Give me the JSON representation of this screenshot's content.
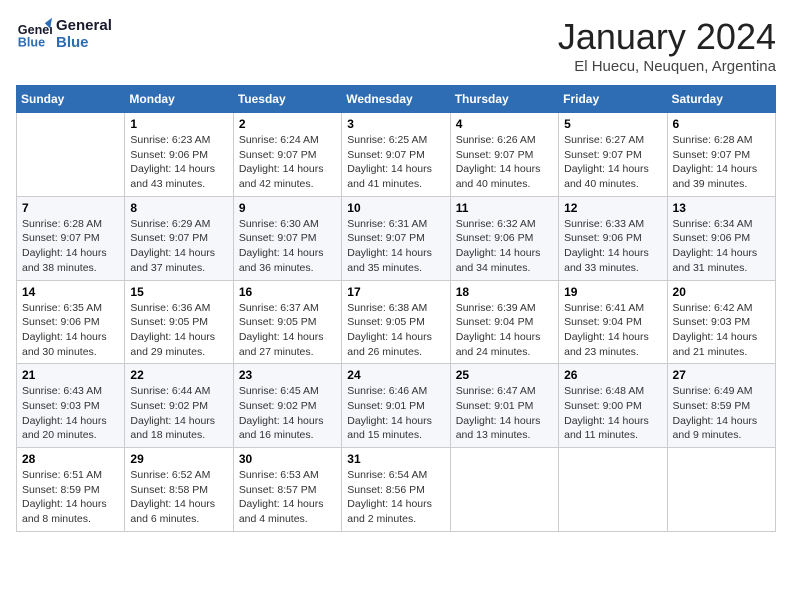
{
  "logo": {
    "line1": "General",
    "line2": "Blue"
  },
  "title": "January 2024",
  "location": "El Huecu, Neuquen, Argentina",
  "weekdays": [
    "Sunday",
    "Monday",
    "Tuesday",
    "Wednesday",
    "Thursday",
    "Friday",
    "Saturday"
  ],
  "weeks": [
    [
      {
        "day": "",
        "sunrise": "",
        "sunset": "",
        "daylight": ""
      },
      {
        "day": "1",
        "sunrise": "Sunrise: 6:23 AM",
        "sunset": "Sunset: 9:06 PM",
        "daylight": "Daylight: 14 hours and 43 minutes."
      },
      {
        "day": "2",
        "sunrise": "Sunrise: 6:24 AM",
        "sunset": "Sunset: 9:07 PM",
        "daylight": "Daylight: 14 hours and 42 minutes."
      },
      {
        "day": "3",
        "sunrise": "Sunrise: 6:25 AM",
        "sunset": "Sunset: 9:07 PM",
        "daylight": "Daylight: 14 hours and 41 minutes."
      },
      {
        "day": "4",
        "sunrise": "Sunrise: 6:26 AM",
        "sunset": "Sunset: 9:07 PM",
        "daylight": "Daylight: 14 hours and 40 minutes."
      },
      {
        "day": "5",
        "sunrise": "Sunrise: 6:27 AM",
        "sunset": "Sunset: 9:07 PM",
        "daylight": "Daylight: 14 hours and 40 minutes."
      },
      {
        "day": "6",
        "sunrise": "Sunrise: 6:28 AM",
        "sunset": "Sunset: 9:07 PM",
        "daylight": "Daylight: 14 hours and 39 minutes."
      }
    ],
    [
      {
        "day": "7",
        "sunrise": "Sunrise: 6:28 AM",
        "sunset": "Sunset: 9:07 PM",
        "daylight": "Daylight: 14 hours and 38 minutes."
      },
      {
        "day": "8",
        "sunrise": "Sunrise: 6:29 AM",
        "sunset": "Sunset: 9:07 PM",
        "daylight": "Daylight: 14 hours and 37 minutes."
      },
      {
        "day": "9",
        "sunrise": "Sunrise: 6:30 AM",
        "sunset": "Sunset: 9:07 PM",
        "daylight": "Daylight: 14 hours and 36 minutes."
      },
      {
        "day": "10",
        "sunrise": "Sunrise: 6:31 AM",
        "sunset": "Sunset: 9:07 PM",
        "daylight": "Daylight: 14 hours and 35 minutes."
      },
      {
        "day": "11",
        "sunrise": "Sunrise: 6:32 AM",
        "sunset": "Sunset: 9:06 PM",
        "daylight": "Daylight: 14 hours and 34 minutes."
      },
      {
        "day": "12",
        "sunrise": "Sunrise: 6:33 AM",
        "sunset": "Sunset: 9:06 PM",
        "daylight": "Daylight: 14 hours and 33 minutes."
      },
      {
        "day": "13",
        "sunrise": "Sunrise: 6:34 AM",
        "sunset": "Sunset: 9:06 PM",
        "daylight": "Daylight: 14 hours and 31 minutes."
      }
    ],
    [
      {
        "day": "14",
        "sunrise": "Sunrise: 6:35 AM",
        "sunset": "Sunset: 9:06 PM",
        "daylight": "Daylight: 14 hours and 30 minutes."
      },
      {
        "day": "15",
        "sunrise": "Sunrise: 6:36 AM",
        "sunset": "Sunset: 9:05 PM",
        "daylight": "Daylight: 14 hours and 29 minutes."
      },
      {
        "day": "16",
        "sunrise": "Sunrise: 6:37 AM",
        "sunset": "Sunset: 9:05 PM",
        "daylight": "Daylight: 14 hours and 27 minutes."
      },
      {
        "day": "17",
        "sunrise": "Sunrise: 6:38 AM",
        "sunset": "Sunset: 9:05 PM",
        "daylight": "Daylight: 14 hours and 26 minutes."
      },
      {
        "day": "18",
        "sunrise": "Sunrise: 6:39 AM",
        "sunset": "Sunset: 9:04 PM",
        "daylight": "Daylight: 14 hours and 24 minutes."
      },
      {
        "day": "19",
        "sunrise": "Sunrise: 6:41 AM",
        "sunset": "Sunset: 9:04 PM",
        "daylight": "Daylight: 14 hours and 23 minutes."
      },
      {
        "day": "20",
        "sunrise": "Sunrise: 6:42 AM",
        "sunset": "Sunset: 9:03 PM",
        "daylight": "Daylight: 14 hours and 21 minutes."
      }
    ],
    [
      {
        "day": "21",
        "sunrise": "Sunrise: 6:43 AM",
        "sunset": "Sunset: 9:03 PM",
        "daylight": "Daylight: 14 hours and 20 minutes."
      },
      {
        "day": "22",
        "sunrise": "Sunrise: 6:44 AM",
        "sunset": "Sunset: 9:02 PM",
        "daylight": "Daylight: 14 hours and 18 minutes."
      },
      {
        "day": "23",
        "sunrise": "Sunrise: 6:45 AM",
        "sunset": "Sunset: 9:02 PM",
        "daylight": "Daylight: 14 hours and 16 minutes."
      },
      {
        "day": "24",
        "sunrise": "Sunrise: 6:46 AM",
        "sunset": "Sunset: 9:01 PM",
        "daylight": "Daylight: 14 hours and 15 minutes."
      },
      {
        "day": "25",
        "sunrise": "Sunrise: 6:47 AM",
        "sunset": "Sunset: 9:01 PM",
        "daylight": "Daylight: 14 hours and 13 minutes."
      },
      {
        "day": "26",
        "sunrise": "Sunrise: 6:48 AM",
        "sunset": "Sunset: 9:00 PM",
        "daylight": "Daylight: 14 hours and 11 minutes."
      },
      {
        "day": "27",
        "sunrise": "Sunrise: 6:49 AM",
        "sunset": "Sunset: 8:59 PM",
        "daylight": "Daylight: 14 hours and 9 minutes."
      }
    ],
    [
      {
        "day": "28",
        "sunrise": "Sunrise: 6:51 AM",
        "sunset": "Sunset: 8:59 PM",
        "daylight": "Daylight: 14 hours and 8 minutes."
      },
      {
        "day": "29",
        "sunrise": "Sunrise: 6:52 AM",
        "sunset": "Sunset: 8:58 PM",
        "daylight": "Daylight: 14 hours and 6 minutes."
      },
      {
        "day": "30",
        "sunrise": "Sunrise: 6:53 AM",
        "sunset": "Sunset: 8:57 PM",
        "daylight": "Daylight: 14 hours and 4 minutes."
      },
      {
        "day": "31",
        "sunrise": "Sunrise: 6:54 AM",
        "sunset": "Sunset: 8:56 PM",
        "daylight": "Daylight: 14 hours and 2 minutes."
      },
      {
        "day": "",
        "sunrise": "",
        "sunset": "",
        "daylight": ""
      },
      {
        "day": "",
        "sunrise": "",
        "sunset": "",
        "daylight": ""
      },
      {
        "day": "",
        "sunrise": "",
        "sunset": "",
        "daylight": ""
      }
    ]
  ]
}
